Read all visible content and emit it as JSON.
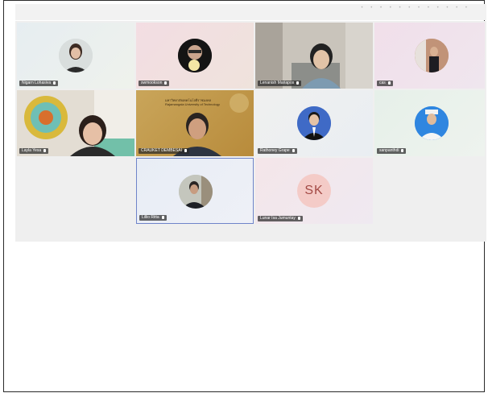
{
  "participants": [
    {
      "name": "Nigarn Lohasiva",
      "initials": ""
    },
    {
      "name": "swmookson",
      "initials": ""
    },
    {
      "name": "Lenanish Mariapos",
      "initials": ""
    },
    {
      "name": "cas",
      "initials": ""
    },
    {
      "name": "Layla Yesa",
      "initials": ""
    },
    {
      "name": "CRAUKET DEMBESAI",
      "initials": ""
    },
    {
      "name": "Rathoney Grape",
      "initials": ""
    },
    {
      "name": "sanpanthdi",
      "initials": ""
    },
    {
      "name": "Lillio Ritta",
      "initials": ""
    },
    {
      "name": "Lunar Isa Jumuntay",
      "initials": "SK"
    }
  ],
  "slide": {
    "line1": "มหาวิทยาลัยเทคโนโลยีราชมงคล",
    "line2": "Rajamangala University of Technology"
  },
  "colors": {
    "stage_bg": "#efefef",
    "active_border": "#6f84c9",
    "initials_bg": "#f4cbc7"
  }
}
